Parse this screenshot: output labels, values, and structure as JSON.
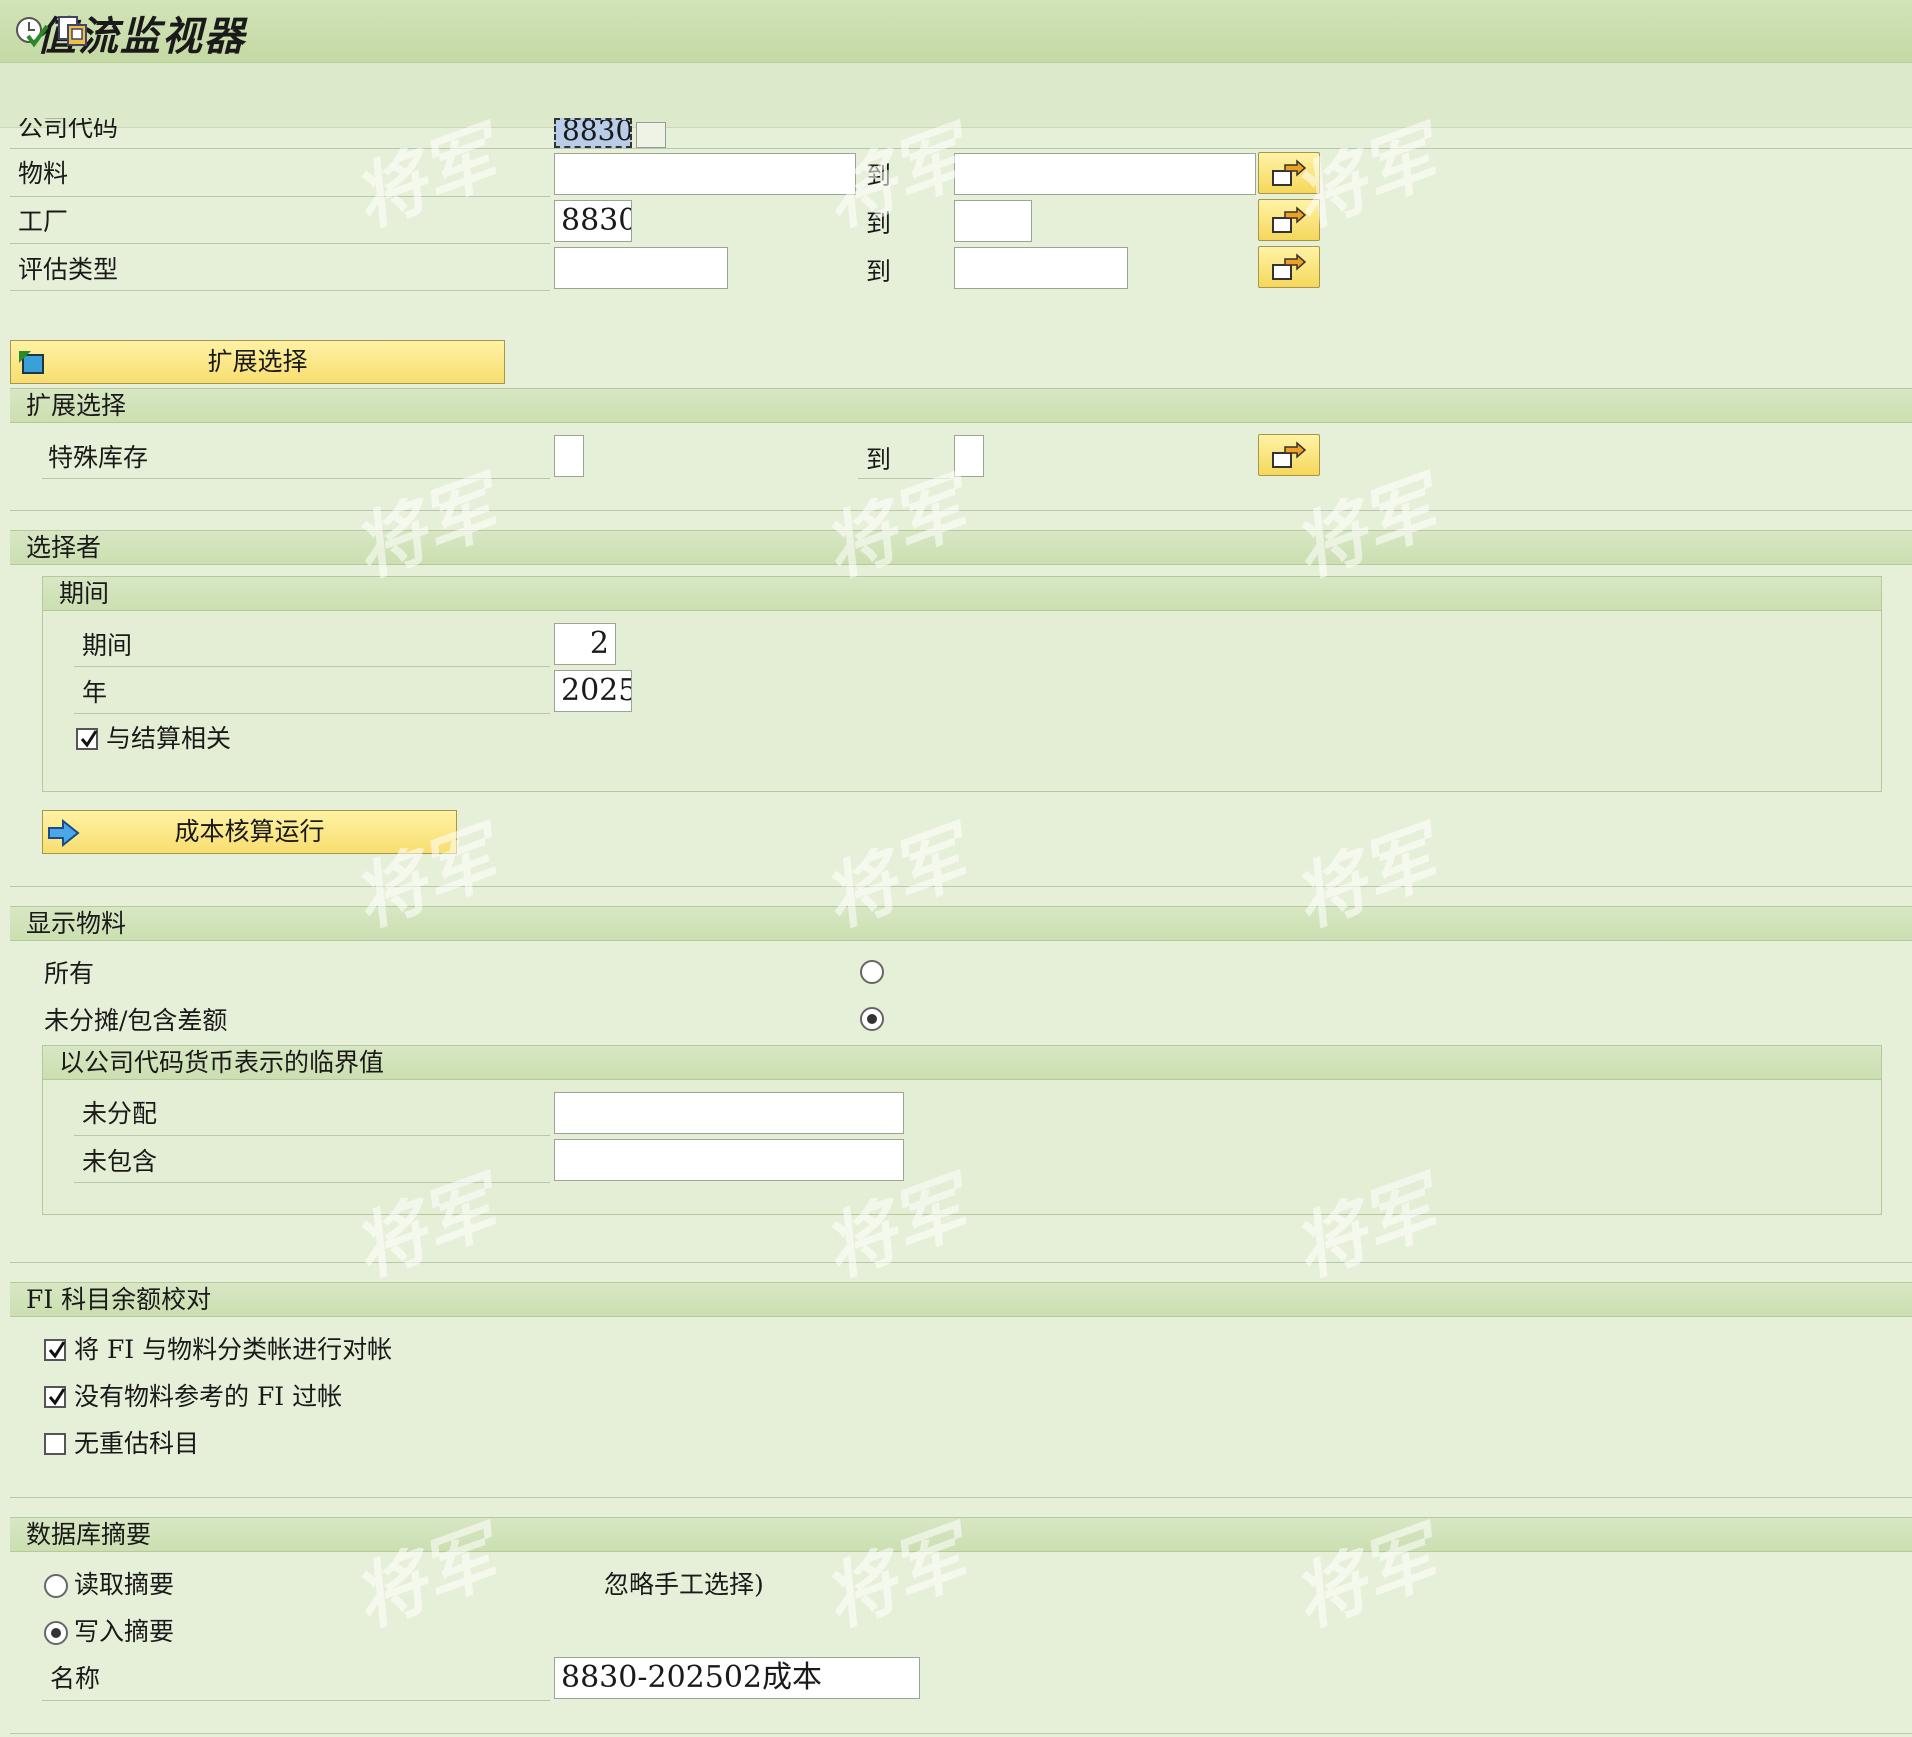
{
  "window": {
    "title": "值流监视器"
  },
  "selection": {
    "company_code": {
      "label": "公司代码",
      "value": "8830"
    },
    "material": {
      "label": "物料",
      "from": "",
      "to_label": "到",
      "to": ""
    },
    "plant": {
      "label": "工厂",
      "from": "8830",
      "to_label": "到",
      "to": ""
    },
    "valuation_type": {
      "label": "评估类型",
      "from": "",
      "to_label": "到",
      "to": ""
    }
  },
  "extended_button": {
    "label": "扩展选择"
  },
  "extended_section": {
    "title": "扩展选择",
    "special_stock": {
      "label": "特殊库存",
      "from": "",
      "to_label": "到",
      "to": ""
    }
  },
  "selector": {
    "title": "选择者",
    "period_group": {
      "title": "期间",
      "period": {
        "label": "期间",
        "value": "2"
      },
      "year": {
        "label": "年",
        "value": "2025"
      },
      "closing_relevant": {
        "label": "与结算相关",
        "checked": true
      }
    },
    "costing_run_button": {
      "label": "成本核算运行"
    }
  },
  "display_material": {
    "title": "显示物料",
    "all": {
      "label": "所有",
      "selected": false
    },
    "unallocated": {
      "label": "未分摊/包含差额",
      "selected": true
    },
    "threshold_group": {
      "title": "以公司代码货币表示的临界值",
      "unallocated": {
        "label": "未分配",
        "value": ""
      },
      "not_included": {
        "label": "未包含",
        "value": ""
      }
    }
  },
  "fi_reconciliation": {
    "title": "FI 科目余额校对",
    "options": [
      {
        "label": "将 FI 与物料分类帐进行对帐",
        "checked": true
      },
      {
        "label": "没有物料参考的 FI 过帐",
        "checked": true
      },
      {
        "label": "无重估科目",
        "checked": false
      }
    ]
  },
  "db_summary": {
    "title": "数据库摘要",
    "read": {
      "label": "读取摘要",
      "selected": false,
      "note": "忽略手工选择)"
    },
    "write": {
      "label": "写入摘要",
      "selected": true
    },
    "name": {
      "label": "名称",
      "value": "8830-202502成本"
    }
  },
  "watermark": {
    "text": "将军"
  },
  "colors": {
    "background": "#e6f0d8",
    "title_bar": "#c4d9a4",
    "button_yellow": "#f7de70"
  }
}
